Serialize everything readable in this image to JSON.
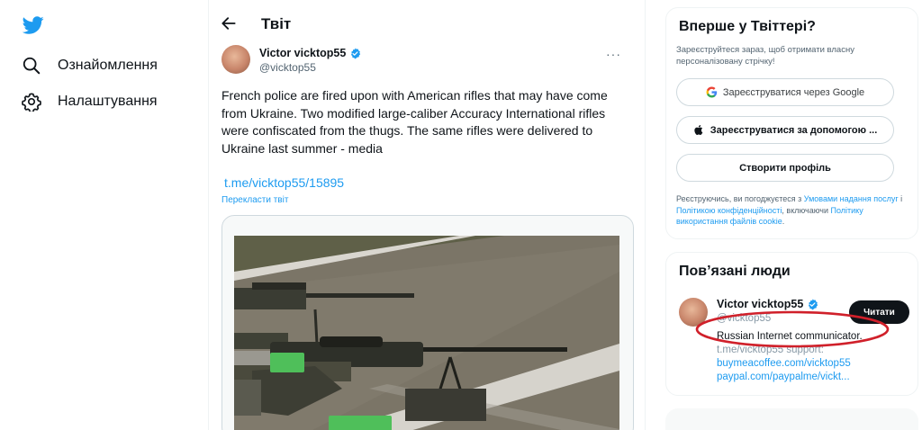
{
  "nav": {
    "logo_icon": "twitter-bird-icon",
    "explore_label": "Ознайомлення",
    "settings_label": "Налаштування"
  },
  "main": {
    "title": "Твіт",
    "tweet": {
      "author_name": "Victor vicktop55",
      "author_handle": "@vicktop55",
      "text": "French police are fired upon with American rifles that may have come from Ukraine.  Two modified large-caliber Accuracy International rifles were confiscated from the thugs.  The same rifles were delivered to Ukraine last summer - media",
      "link": "t.me/vicktop55/15895",
      "translate": "Перекласти твіт",
      "more": "···"
    }
  },
  "signup": {
    "title": "Вперше у Твіттері?",
    "subtitle": "Зареєструйтеся зараз, щоб отримати власну персоналізовану стрічку!",
    "google_btn": "Зареєструватися через Google",
    "apple_btn": "Зареєструватися за допомогою ...",
    "create_btn": "Створити профіль",
    "legal_1": "Реєструючись, ви погоджуєтеся з ",
    "legal_terms": "Умовами надання послуг",
    "legal_2": " і ",
    "legal_privacy": "Політикою конфіденційності",
    "legal_3": ", включаючи ",
    "legal_cookies": "Політику використання файлів cookie",
    "legal_4": "."
  },
  "related": {
    "title": "Пов’язані люди",
    "name": "Victor vicktop55",
    "handle": "@vicktop55",
    "follow": "Читати",
    "bio_1": "Russian Internet communicator.",
    "bio_2": "t.me/vicktop55 support:",
    "bio_link_1": "buymeacoffee.com/vicktop55",
    "bio_link_2": "paypal.com/paypalme/vickt..."
  },
  "colors": {
    "accent": "#1d9bf0",
    "annotation": "#d0202a"
  }
}
